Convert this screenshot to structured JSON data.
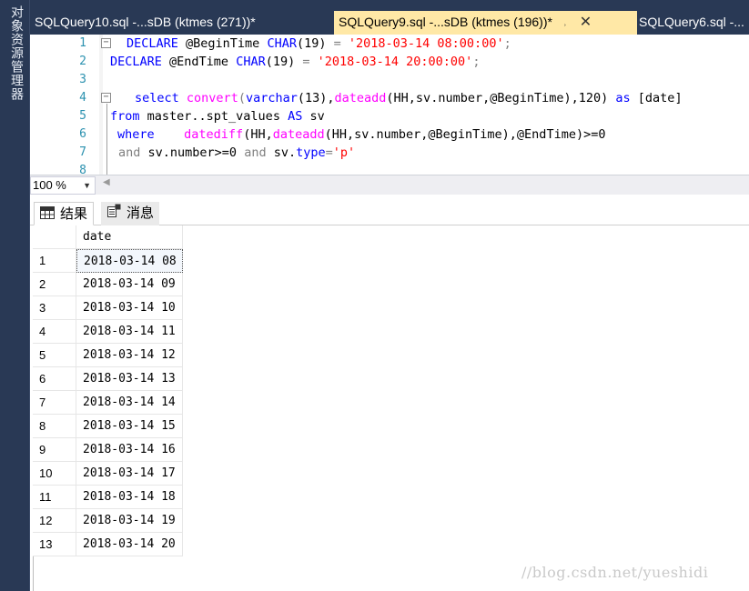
{
  "sidebar": {
    "label": "对象资源管理器"
  },
  "tabs": [
    {
      "label": "SQLQuery10.sql -...sDB (ktmes (271))*",
      "active": false
    },
    {
      "label": "SQLQuery9.sql -...sDB (ktmes (196))*",
      "active": true,
      "pin_icon": "pin-icon",
      "close_icon": "close-icon"
    },
    {
      "label": "SQLQuery6.sql -...",
      "active": false
    }
  ],
  "editor": {
    "line_numbers": [
      "1",
      "2",
      "3",
      "4",
      "5",
      "6",
      "7",
      "8"
    ],
    "lines": {
      "l1": {
        "kw1": "DECLARE",
        "var": " @BeginTime ",
        "kw2": "CHAR",
        "args": "(19) ",
        "eq": "=",
        "sp": " ",
        "str": "'2018-03-14 08:00:00'",
        "end": ";"
      },
      "l2": {
        "kw1": "DECLARE",
        "var": " @EndTime ",
        "kw2": "CHAR",
        "args": "(19) ",
        "eq": "=",
        "sp": " ",
        "str": "'2018-03-14 20:00:00'",
        "end": ";"
      },
      "l4": {
        "kw1": "select",
        "fn1": "convert",
        "p1": "(",
        "kw2": "varchar",
        "p2": "(13),",
        "fn2": "dateadd",
        "p3": "(HH,sv.number,@BeginTime),120)",
        "kw3": "as",
        "alias": " [date]"
      },
      "l5": {
        "kw1": "from",
        "obj": " master..spt_values ",
        "kw2": "AS",
        "alias": " sv"
      },
      "l6": {
        "kw1": "where",
        "fn1": "datediff",
        "p1": "(HH,",
        "fn2": "dateadd",
        "p2": "(HH,sv.number,@BeginTime),@EndTime)>=0"
      },
      "l7": {
        "kw1": "and",
        "p1": " sv.number>=0 ",
        "kw2": "and",
        "p2": " sv.",
        "kw3": "type",
        "op": "=",
        "str": "'p'"
      }
    }
  },
  "zoom": {
    "value": "100 %",
    "icon": "chevron-down-icon"
  },
  "results_tabs": [
    {
      "label": "结果",
      "icon": "grid-icon",
      "active": true
    },
    {
      "label": "消息",
      "icon": "message-icon",
      "active": false
    }
  ],
  "grid": {
    "columns": [
      "date"
    ],
    "rows": [
      {
        "num": "1",
        "date": "2018-03-14 08"
      },
      {
        "num": "2",
        "date": "2018-03-14 09"
      },
      {
        "num": "3",
        "date": "2018-03-14 10"
      },
      {
        "num": "4",
        "date": "2018-03-14 11"
      },
      {
        "num": "5",
        "date": "2018-03-14 12"
      },
      {
        "num": "6",
        "date": "2018-03-14 13"
      },
      {
        "num": "7",
        "date": "2018-03-14 14"
      },
      {
        "num": "8",
        "date": "2018-03-14 15"
      },
      {
        "num": "9",
        "date": "2018-03-14 16"
      },
      {
        "num": "10",
        "date": "2018-03-14 17"
      },
      {
        "num": "11",
        "date": "2018-03-14 18"
      },
      {
        "num": "12",
        "date": "2018-03-14 19"
      },
      {
        "num": "13",
        "date": "2018-03-14 20"
      }
    ]
  },
  "watermark": "//blog.csdn.net/yueshidi",
  "colors": {
    "sidebar_bg": "#293955",
    "active_tab": "#ffe8a6",
    "keyword": "#0000ff",
    "function": "#ff00ff",
    "string": "#ff0000",
    "line_number": "#2b91af"
  }
}
